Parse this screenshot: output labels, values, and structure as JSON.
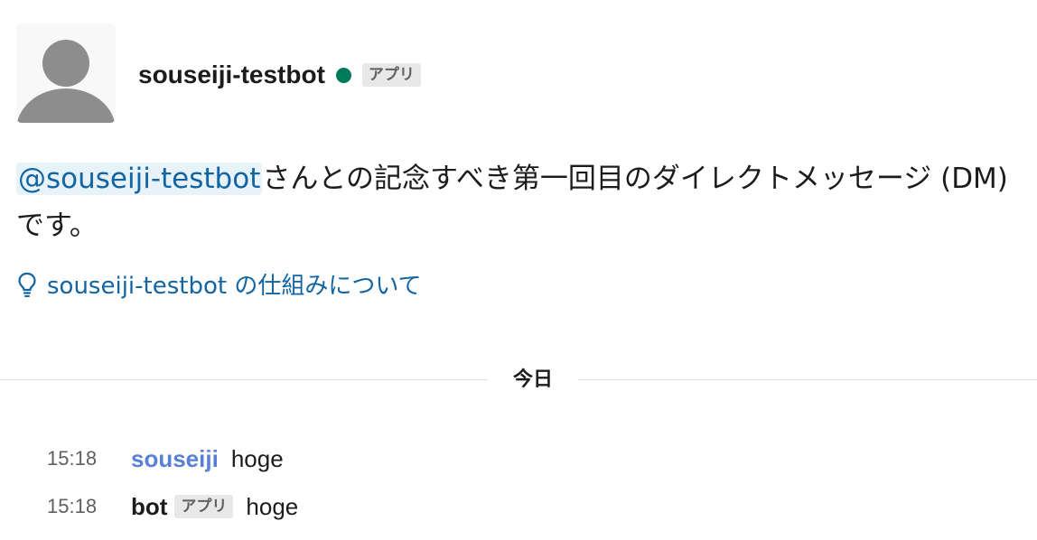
{
  "colors": {
    "presence": "#007a5a",
    "link": "#1264a3",
    "mention_bg": "#e8f3f9",
    "user_name": "#5a7fd6",
    "badge_bg": "#e8e8e8"
  },
  "header": {
    "avatar_icon": "default-user-avatar-icon",
    "bot_name": "souseiji-testbot",
    "presence_status": "online",
    "app_badge": "アプリ"
  },
  "intro": {
    "mention": "@souseiji-testbot",
    "text": "さんとの記念すべき第一回目のダイレクトメッセージ (DM) です。"
  },
  "howto_link": {
    "icon": "lightbulb-icon",
    "label": "souseiji-testbot の仕組みについて"
  },
  "day_divider": {
    "label": "今日"
  },
  "messages": [
    {
      "time": "15:18",
      "author": "souseiji",
      "badge": "",
      "text": "hoge"
    },
    {
      "time": "15:18",
      "author": "bot",
      "badge": "アプリ",
      "text": "hoge"
    }
  ]
}
